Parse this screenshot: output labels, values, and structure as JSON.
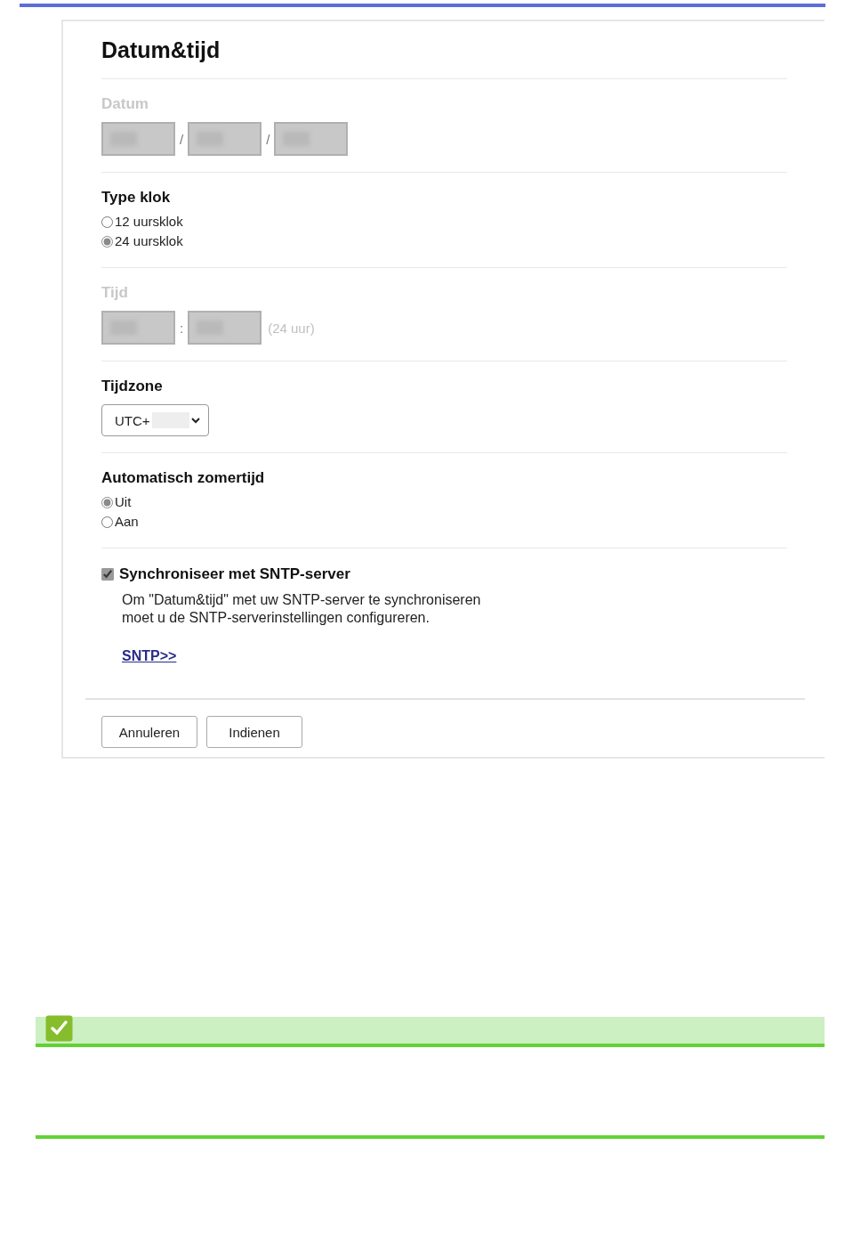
{
  "panel": {
    "title": "Datum&tijd",
    "date": {
      "label": "Datum",
      "disabled": true,
      "parts": [
        {
          "kind": "field"
        },
        {
          "kind": "separator",
          "text": "/"
        },
        {
          "kind": "field"
        },
        {
          "kind": "separator",
          "text": "/"
        },
        {
          "kind": "field"
        }
      ]
    },
    "clock_type": {
      "label": "Type klok",
      "options": [
        {
          "label": "12 uursklok",
          "selected": false
        },
        {
          "label": "24 uursklok",
          "selected": true
        }
      ]
    },
    "time": {
      "label": "Tijd",
      "disabled": true,
      "parts": [
        {
          "kind": "field"
        },
        {
          "kind": "separator",
          "text": ":"
        },
        {
          "kind": "field"
        }
      ],
      "hint": "(24 uur)"
    },
    "timezone": {
      "label": "Tijdzone",
      "value": "UTC+"
    },
    "dst": {
      "label": "Automatisch zomertijd",
      "options": [
        {
          "label": "Uit",
          "selected": true
        },
        {
          "label": "Aan",
          "selected": false
        }
      ]
    },
    "sntp": {
      "label": "Synchroniseer met SNTP-server",
      "checked": true,
      "description": [
        "Om \"Datum&tijd\" met uw SNTP-server te synchroniseren",
        "moet u de SNTP-serverinstellingen configureren."
      ],
      "link": "SNTP>>"
    },
    "buttons": [
      "Annuleren",
      "Indienen"
    ]
  }
}
